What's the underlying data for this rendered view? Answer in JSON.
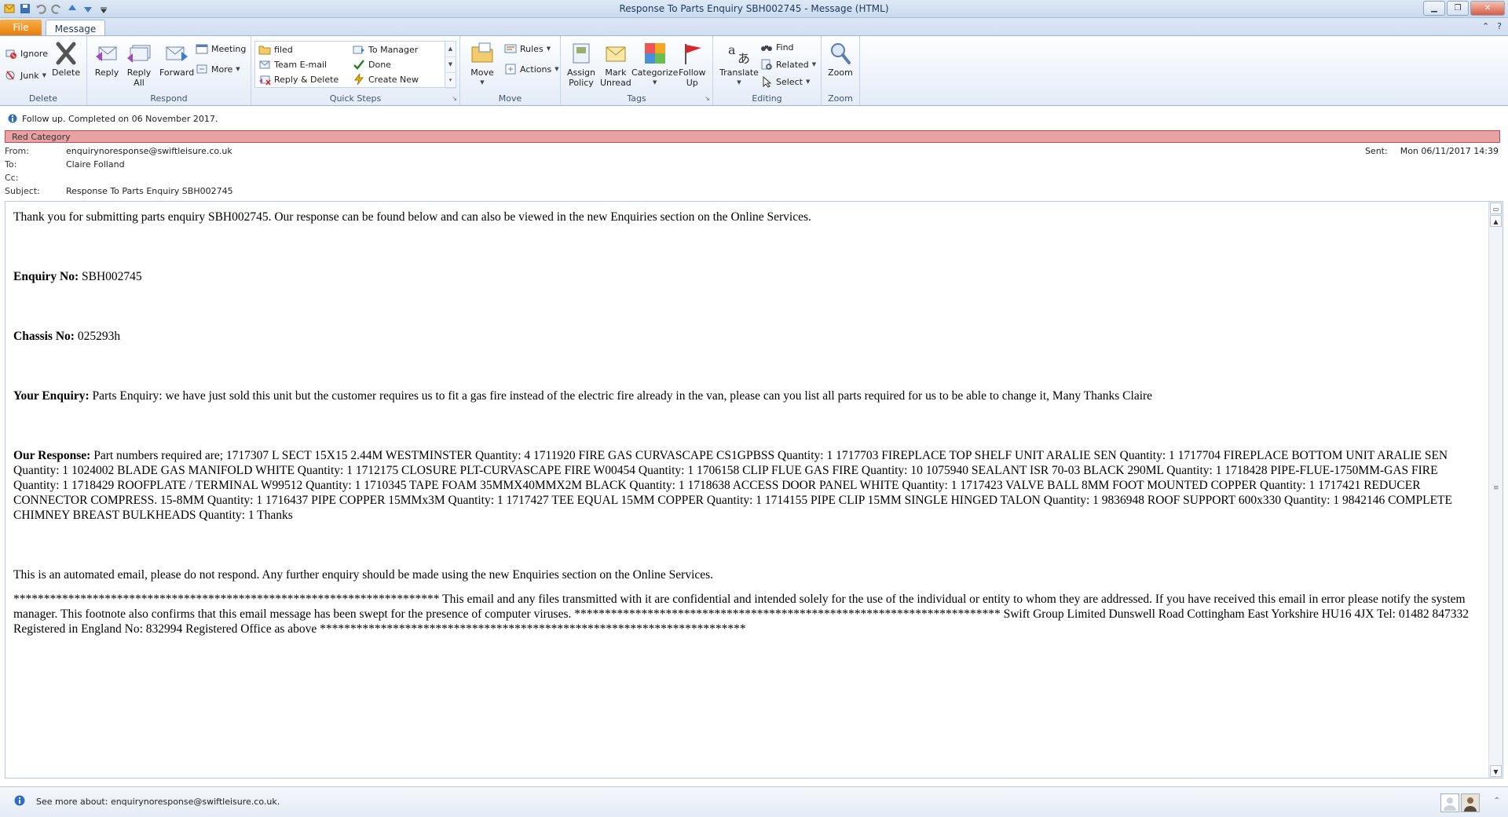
{
  "window": {
    "title": "Response To Parts Enquiry SBH002745  -  Message (HTML)",
    "controls": [
      "minimize",
      "restore",
      "close"
    ]
  },
  "tabs": {
    "file": "File",
    "message": "Message"
  },
  "ribbon": {
    "delete_group": {
      "label": "Delete",
      "ignore": "Ignore",
      "junk": "Junk",
      "delete": "Delete"
    },
    "respond_group": {
      "label": "Respond",
      "reply": "Reply",
      "reply_all_1": "Reply",
      "reply_all_2": "All",
      "forward": "Forward",
      "meeting": "Meeting",
      "more": "More"
    },
    "quicksteps_group": {
      "label": "Quick Steps",
      "items": [
        "filed",
        "To Manager",
        "Team E-mail",
        "Done",
        "Reply & Delete",
        "Create New"
      ]
    },
    "move_group": {
      "label": "Move",
      "move": "Move",
      "rules": "Rules",
      "actions": "Actions"
    },
    "tags_group": {
      "label": "Tags",
      "assign_1": "Assign",
      "assign_2": "Policy",
      "mark_1": "Mark",
      "mark_2": "Unread",
      "categorize": "Categorize",
      "follow_1": "Follow",
      "follow_2": "Up"
    },
    "editing_group": {
      "label": "Editing",
      "translate": "Translate",
      "find": "Find",
      "related": "Related",
      "select": "Select"
    },
    "zoom_group": {
      "label": "Zoom",
      "zoom": "Zoom"
    }
  },
  "infobar": {
    "followup": "Follow up.  Completed on 06 November 2017.",
    "category": "Red Category"
  },
  "header": {
    "from_label": "From:",
    "from": "enquirynoresponse@swiftleisure.co.uk",
    "to_label": "To:",
    "to": "Claire Folland",
    "cc_label": "Cc:",
    "cc": "",
    "subject_label": "Subject:",
    "subject": "Response To Parts Enquiry SBH002745",
    "sent_label": "Sent:",
    "sent": "Mon 06/11/2017 14:39"
  },
  "body": {
    "intro": "Thank you for submitting parts enquiry SBH002745. Our response can be found below and can also be viewed in the new Enquiries section on the Online Services.",
    "enquiry_label": "Enquiry No:",
    "enquiry_value": " SBH002745",
    "chassis_label": "Chassis No:",
    "chassis_value": " 025293h",
    "your_enquiry_label": "Your Enquiry:",
    "your_enquiry_value": " Parts Enquiry: we have just sold this unit but the customer requires us to fit a gas fire instead of the electric fire already in the van, please can you list all parts required for us to be able to change it, Many Thanks Claire",
    "response_label": "Our Response:",
    "response_value": " Part numbers required are; 1717307 L SECT 15X15 2.44M WESTMINSTER Quantity: 4 1711920 FIRE GAS CURVASCAPE CS1GPBSS Quantity: 1 1717703 FIREPLACE TOP SHELF UNIT ARALIE SEN Quantity: 1 1717704 FIREPLACE BOTTOM UNIT ARALIE SEN Quantity: 1 1024002 BLADE GAS MANIFOLD WHITE Quantity: 1 1712175 CLOSURE PLT-CURVASCAPE FIRE W00454 Quantity: 1 1706158 CLIP FLUE GAS FIRE Quantity: 10 1075940 SEALANT ISR 70-03 BLACK 290ML Quantity: 1 1718428 PIPE-FLUE-1750MM-GAS FIRE Quantity: 1 1718429 ROOFPLATE / TERMINAL W99512 Quantity: 1 1710345 TAPE FOAM 35MMX40MMX2M BLACK Quantity: 1 1718638 ACCESS DOOR PANEL WHITE Quantity: 1 1717423 VALVE BALL 8MM FOOT MOUNTED COPPER Quantity: 1 1717421 REDUCER CONNECTOR COMPRESS. 15-8MM Quantity: 1 1716437 PIPE COPPER 15MMx3M Quantity: 1 1717427 TEE EQUAL 15MM COPPER Quantity: 1 1714155 PIPE CLIP 15MM SINGLE HINGED TALON Quantity: 1 9836948 ROOF SUPPORT 600x330 Quantity: 1 9842146 COMPLETE CHIMNEY BREAST BULKHEADS Quantity: 1 Thanks",
    "automated": "This is an automated email, please do not respond. Any further enquiry should be made using the new Enquiries section on the Online Services.",
    "footer": "********************************************************************** This email and any files transmitted with it are confidential and intended solely for the use of the individual or entity to whom they are addressed. If you have received this email in error please notify the system manager. This footnote also confirms that this email message has been swept for the presence of computer viruses. ********************************************************************** Swift Group Limited Dunswell Road Cottingham East Yorkshire HU16 4JX Tel: 01482 847332 Registered in England No: 832994 Registered Office as above **********************************************************************"
  },
  "people_pane": {
    "text": "See more about: enquirynoresponse@swiftleisure.co.uk."
  },
  "colors": {
    "accent": "#1e395b",
    "file_tab": "#e87e0c",
    "category": "#e7a2a4",
    "category_border": "#c04a50"
  }
}
